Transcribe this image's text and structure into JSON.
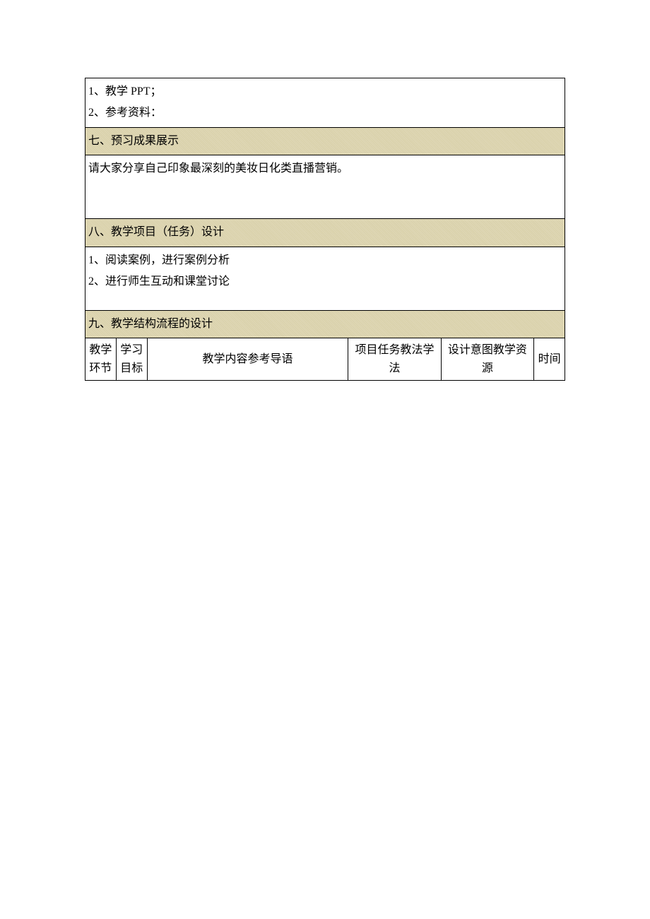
{
  "sections": {
    "resources": {
      "item1": "1、教学 PPT；",
      "item2": "2、参考资料："
    },
    "seven": {
      "title": "七、预习成果展示",
      "content": "请大家分享自己印象最深刻的美妆日化类直播营销。"
    },
    "eight": {
      "title": "八、教学项目（任务）设计",
      "item1": "1、阅读案例，进行案例分析",
      "item2": "2、进行师生互动和课堂讨论"
    },
    "nine": {
      "title": "九、教学结构流程的设计",
      "headers": {
        "col1": "教学环节",
        "col2": "学习目标",
        "col3": "教学内容参考导语",
        "col4": "项目任务教法学法",
        "col5": "设计意图教学资源",
        "col6": "时间"
      }
    }
  }
}
